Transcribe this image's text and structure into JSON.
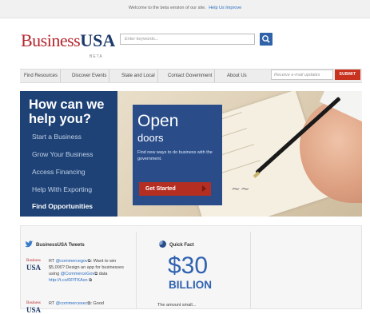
{
  "beta_bar": {
    "message": "Welcome to the beta version of our site.",
    "improve_link": "Help Us Improve"
  },
  "brand": {
    "name_part1": "Business",
    "name_part2": "USA",
    "tag": "BETA",
    "color_red": "#b5252c",
    "color_navy": "#1d3a6a"
  },
  "search": {
    "placeholder": "Enter keywords...",
    "button_icon": "search-icon"
  },
  "nav": {
    "items": [
      "Find Resources",
      "Discover Events",
      "State and Local",
      "Contact Government",
      "About Us"
    ]
  },
  "email_signup": {
    "placeholder": "Receive e-mail updates",
    "submit_label": "SUBMIT"
  },
  "hero": {
    "title": "How can we help you?",
    "menu_items": [
      "Start a Business",
      "Grow Your Business",
      "Access Financing",
      "Help With Exporting",
      "Find Opportunities"
    ],
    "active_item": "Find Opportunities",
    "feature": {
      "title": "Open",
      "subtitle": "doors",
      "description": "Find new ways to do business with the government.",
      "cta_label": "Get Started"
    }
  },
  "tweets": {
    "title": "BusinessUSA Tweets",
    "logo_text_top": "Business",
    "logo_text_bottom": "USA",
    "items": [
      {
        "prefix": "RT ",
        "handle": "@commercegov",
        "text_1": ": Want to win $5,000? Design an app for businesses using ",
        "handle_2": "@CommerceGov",
        "text_2": " data ",
        "link": "http://t.co/0FfTKAsn"
      },
      {
        "prefix": "RT ",
        "handle": "@commercesec",
        "text_1": ": Good"
      }
    ]
  },
  "quick_fact": {
    "title": "Quick Fact",
    "amount": "$30",
    "unit": "BILLION",
    "description": "The amount small..."
  }
}
